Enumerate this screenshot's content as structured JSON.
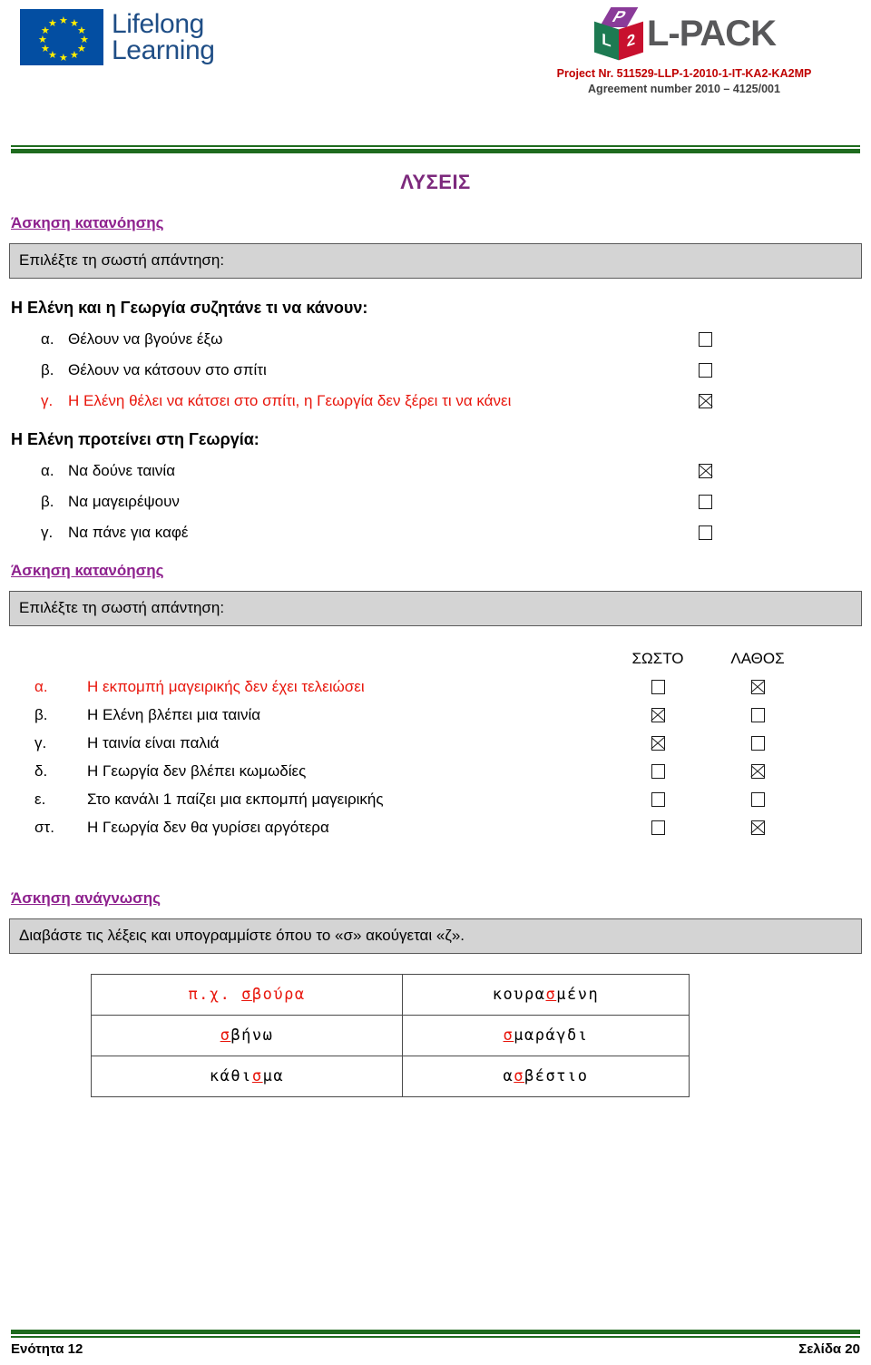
{
  "header": {
    "eu_logo": {
      "line1": "Lifelong",
      "line2": "Learning"
    },
    "lpack": {
      "cube_top": "P",
      "cube_left": "L",
      "cube_right": "2",
      "wordmark": "L-PACK",
      "project_line": "Project Nr. 511529-LLP-1-2010-1-IT-KA2-KA2MP",
      "agreement_line": "Agreement number 2010 – 4125/001"
    },
    "rule_color": "#1e6b1e"
  },
  "page_title": "ΛΥΣΕΙΣ",
  "accent_colors": {
    "heading_purple": "#8e218e",
    "title_purple": "#7d2a7d",
    "answer_red": "#e8160c",
    "rule_green": "#1e6b1e",
    "box_gray": "#d4d4d4"
  },
  "exercise1": {
    "heading": "Άσκηση κατανόησης",
    "instruction": "Επιλέξτε τη σωστή απάντηση:",
    "question1": {
      "prompt": "Η Ελένη και η Γεωργία συζητάνε τι να κάνουν:",
      "options": [
        {
          "letter": "α.",
          "text": "Θέλουν να βγούνε έξω",
          "checked": false,
          "correct": false
        },
        {
          "letter": "β.",
          "text": "Θέλουν να κάτσουν στο σπίτι",
          "checked": false,
          "correct": false
        },
        {
          "letter": "γ.",
          "text": "Η Ελένη θέλει να κάτσει στο σπίτι, η Γεωργία δεν ξέρει τι να κάνει",
          "checked": true,
          "correct": true
        }
      ]
    },
    "question2": {
      "prompt": "Η Ελένη προτείνει στη Γεωργία:",
      "options": [
        {
          "letter": "α.",
          "text": "Να δούνε ταινία",
          "checked": true,
          "correct": false
        },
        {
          "letter": "β.",
          "text": "Να μαγειρέψουν",
          "checked": false,
          "correct": false
        },
        {
          "letter": "γ.",
          "text": "Να πάνε για καφέ",
          "checked": false,
          "correct": false
        }
      ]
    }
  },
  "exercise2": {
    "heading": "Άσκηση κατανόησης",
    "instruction": "Επιλέξτε τη σωστή απάντηση:",
    "col_true": "ΣΩΣΤΟ",
    "col_false": "ΛΑΘΟΣ",
    "rows": [
      {
        "letter": "α.",
        "text": "Η εκπομπή μαγειρικής δεν έχει τελειώσει",
        "true_checked": false,
        "false_checked": true,
        "red": true
      },
      {
        "letter": "β.",
        "text": "Η Ελένη βλέπει μια ταινία",
        "true_checked": true,
        "false_checked": false,
        "red": false
      },
      {
        "letter": "γ.",
        "text": "Η ταινία είναι παλιά",
        "true_checked": true,
        "false_checked": false,
        "red": false
      },
      {
        "letter": "δ.",
        "text": "Η Γεωργία δεν βλέπει κωμωδίες",
        "true_checked": false,
        "false_checked": true,
        "red": false
      },
      {
        "letter": "ε.",
        "text": "Στο κανάλι 1 παίζει μια εκπομπή μαγειρικής",
        "true_checked": false,
        "false_checked": false,
        "red": false
      },
      {
        "letter": "στ.",
        "text": "Η Γεωργία δεν θα γυρίσει αργότερα",
        "true_checked": false,
        "false_checked": true,
        "red": false
      }
    ]
  },
  "exercise3": {
    "heading": "Άσκηση ανάγνωσης",
    "instruction": "Διαβάστε τις λέξεις και υπογραμμίστε όπου το «σ» ακούγεται «ζ».",
    "words": [
      {
        "left": {
          "pre": "π.χ. ",
          "hl": "σ",
          "post": "βούρα",
          "all_red": true
        },
        "right": {
          "pre": "κουρα",
          "hl": "σ",
          "post": "μένη",
          "all_red": false
        }
      },
      {
        "left": {
          "pre": "",
          "hl": "σ",
          "post": "βήνω",
          "all_red": false
        },
        "right": {
          "pre": "",
          "hl": "σ",
          "post": "μαράγδι",
          "all_red": false
        }
      },
      {
        "left": {
          "pre": "κάθι",
          "hl": "σ",
          "post": "μα",
          "all_red": false
        },
        "right": {
          "pre": "α",
          "hl": "σ",
          "post": "βέστιο",
          "all_red": false
        }
      }
    ]
  },
  "footer": {
    "unit": "Ενότητα 12",
    "page": "Σελίδα 20"
  }
}
